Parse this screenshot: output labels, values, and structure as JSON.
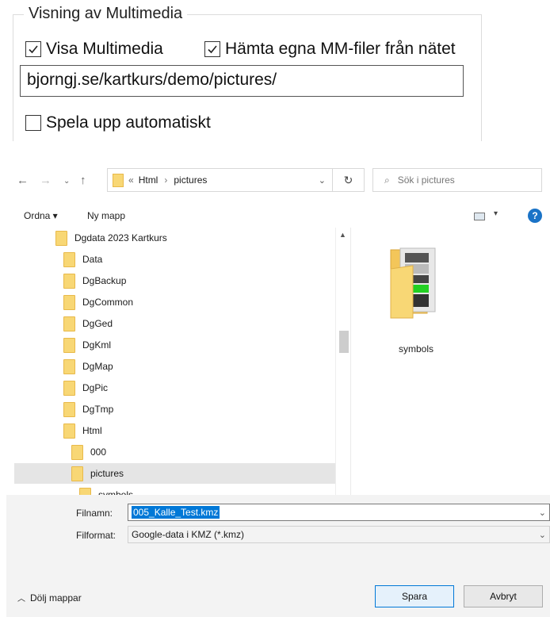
{
  "multimedia": {
    "legend": "Visning av  Multimedia",
    "show_multimedia": {
      "label": "Visa Multimedia",
      "checked": true
    },
    "fetch_own_files": {
      "label": "Hämta egna MM-filer från nätet",
      "checked": true
    },
    "url_value": "bjorngj.se/kartkurs/demo/pictures/",
    "autoplay": {
      "label": "Spela upp  automatiskt",
      "checked": false
    }
  },
  "dialog": {
    "path": {
      "overflow": "«",
      "segments": [
        "Html",
        "pictures"
      ],
      "separator": "›"
    },
    "search_placeholder": "Sök i pictures",
    "toolbar": {
      "organize": "Ordna ▾",
      "new_folder": "Ny mapp"
    },
    "tree": [
      {
        "label": "Dgdata 2023 Kartkurs"
      },
      {
        "label": "Data"
      },
      {
        "label": "DgBackup"
      },
      {
        "label": "DgCommon"
      },
      {
        "label": "DgGed"
      },
      {
        "label": "DgKml"
      },
      {
        "label": "DgMap"
      },
      {
        "label": "DgPic"
      },
      {
        "label": "DgTmp"
      },
      {
        "label": "Html"
      },
      {
        "label": "000"
      },
      {
        "label": "pictures",
        "selected": true
      },
      {
        "label": "symbols"
      }
    ],
    "content_items": [
      {
        "label": "symbols"
      }
    ],
    "filename": {
      "label": "Filnamn:",
      "value": "005_Kalle_Test.kmz"
    },
    "filetype": {
      "label": "Filformat:",
      "value": "Google-data i KMZ (*.kmz)"
    },
    "hide_folders": "Dölj mappar",
    "save": "Spara",
    "cancel": "Avbryt"
  }
}
